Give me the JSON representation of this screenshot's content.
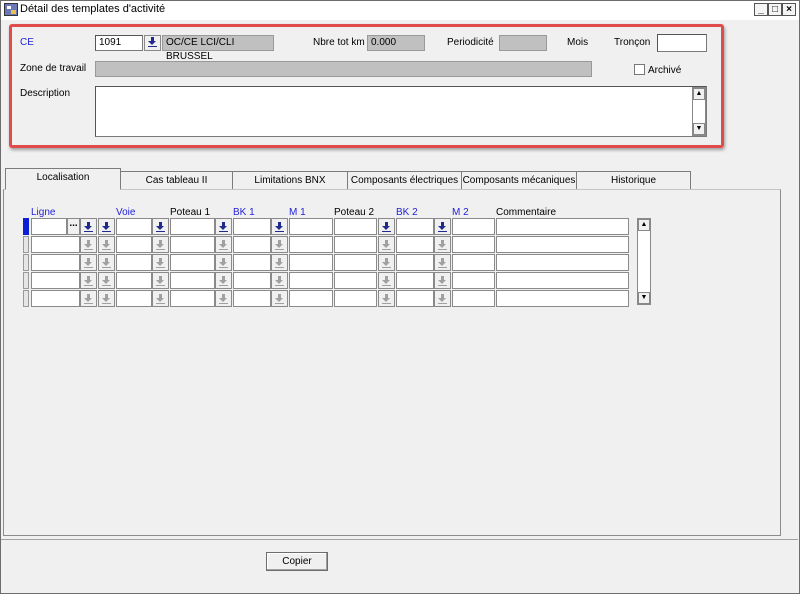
{
  "window": {
    "title": "Détail des templates d'activité",
    "controls": {
      "minimize": "_",
      "maximize": "□",
      "close": "×"
    }
  },
  "header": {
    "ce_label": "CE",
    "ce_code": "1091",
    "ce_name": "OC/CE LCI/CLI BRUSSEL",
    "nbre_tot_km_label": "Nbre tot km",
    "nbre_tot_km_value": "0.000",
    "periodicite_label": "Periodicité",
    "periodicite_value": "",
    "mois_label": "Mois",
    "troncon_label": "Tronçon",
    "troncon_value": "",
    "zone_label": "Zone de travail",
    "zone_value": "",
    "archive_label": "Archivé",
    "archive_checked": false,
    "description_label": "Description",
    "description_value": ""
  },
  "tabs": [
    {
      "label": "Localisation",
      "active": true
    },
    {
      "label": "Cas tableau II",
      "active": false
    },
    {
      "label": "Limitations BNX",
      "active": false
    },
    {
      "label": "Composants électriques",
      "active": false
    },
    {
      "label": "Composants mécaniques",
      "active": false
    },
    {
      "label": "Historique",
      "active": false
    }
  ],
  "grid": {
    "columns": {
      "ligne": "Ligne",
      "voie": "Voie",
      "poteau1": "Poteau 1",
      "bk1": "BK 1",
      "m1": "M 1",
      "poteau2": "Poteau 2",
      "bk2": "BK 2",
      "m2": "M 2",
      "commentaire": "Commentaire"
    },
    "rows": [
      {
        "ligne": "",
        "voie": "",
        "poteau1": "",
        "bk1": "",
        "m1": "",
        "poteau2": "",
        "bk2": "",
        "m2": "",
        "commentaire": ""
      },
      {
        "ligne": "",
        "voie": "",
        "poteau1": "",
        "bk1": "",
        "m1": "",
        "poteau2": "",
        "bk2": "",
        "m2": "",
        "commentaire": ""
      },
      {
        "ligne": "",
        "voie": "",
        "poteau1": "",
        "bk1": "",
        "m1": "",
        "poteau2": "",
        "bk2": "",
        "m2": "",
        "commentaire": ""
      },
      {
        "ligne": "",
        "voie": "",
        "poteau1": "",
        "bk1": "",
        "m1": "",
        "poteau2": "",
        "bk2": "",
        "m2": "",
        "commentaire": ""
      },
      {
        "ligne": "",
        "voie": "",
        "poteau1": "",
        "bk1": "",
        "m1": "",
        "poteau2": "",
        "bk2": "",
        "m2": "",
        "commentaire": ""
      }
    ],
    "lookup_glyph": "..."
  },
  "footer": {
    "copier_label": "Copier"
  },
  "colors": {
    "label_blue": "#2323d8",
    "highlight_red": "#e04c4c",
    "selected_row": "#0b1fd6"
  }
}
